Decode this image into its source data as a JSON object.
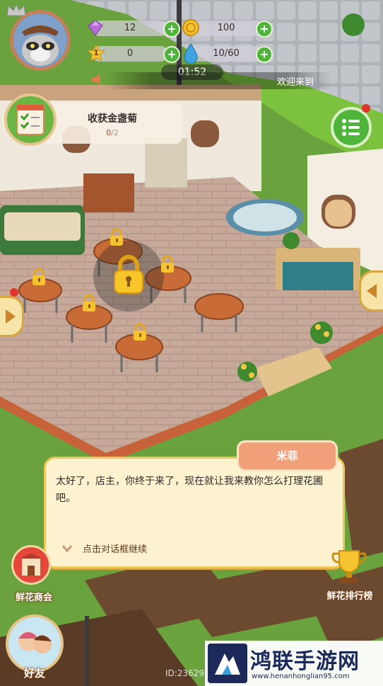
{
  "hud": {
    "gems": "12",
    "coins": "100",
    "level": "1",
    "stars": "0",
    "water": "10/60",
    "timer": "01:52",
    "marquee": "欢迎来到"
  },
  "task": {
    "title": "收获金盏菊",
    "progress_current": "0",
    "progress_sep": "/",
    "progress_total": "2"
  },
  "dialog": {
    "speaker": "米菲",
    "text": "太好了，店主，你终于来了，现在就让我来教你怎么打理花圃吧。",
    "hint": "点击对话框继续"
  },
  "buttons": {
    "shop": "鲜花商会",
    "ranking": "鲜花排行榜",
    "friends": "好友"
  },
  "footer": {
    "player_id": "ID:23629",
    "watermark_title": "鸿联手游网",
    "watermark_url": "www.henanhonglian95.com"
  },
  "colors": {
    "accent_green": "#4fb53a",
    "dialog_bg": "#fdf2cf",
    "nameplate": "#f2a07a",
    "hint_text": "#5b3a1a"
  }
}
